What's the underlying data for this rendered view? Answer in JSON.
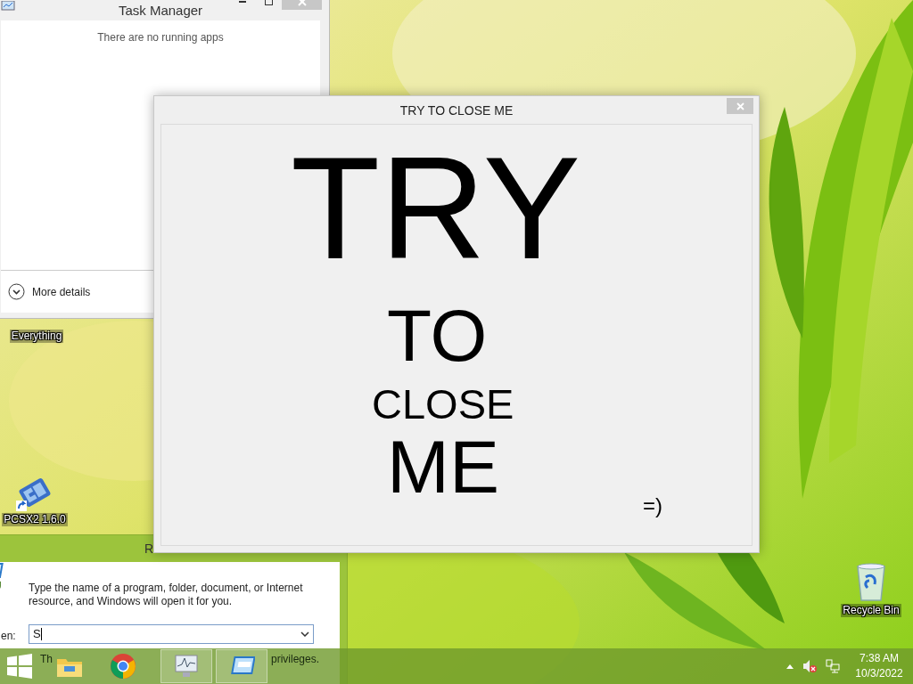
{
  "task_manager": {
    "title": "Task Manager",
    "empty_message": "There are no running apps",
    "more_details": "More details"
  },
  "desktop_icons": [
    {
      "kind": "label_only",
      "label": "Everything"
    },
    {
      "kind": "pcsx2",
      "label": "PCSX2 1.6.0"
    },
    {
      "kind": "recycle_bin",
      "label": "Recycle Bin"
    }
  ],
  "run_dialog": {
    "title": "R",
    "description": "Type the name of a program, folder, document, or Internet resource, and Windows will open it for you.",
    "open_label": "en:",
    "value": "S",
    "admin_note_parts": [
      "Th",
      "privileges."
    ]
  },
  "popup": {
    "title": "TRY TO CLOSE ME",
    "lines": [
      "TRY",
      "TO",
      "CLOSE",
      "ME"
    ],
    "smiley": "=)"
  },
  "taskbar": {
    "apps": [
      {
        "kind": "explorer",
        "running": false
      },
      {
        "kind": "chrome",
        "running": false
      },
      {
        "kind": "task_manager",
        "running": true
      },
      {
        "kind": "run",
        "running": true
      }
    ],
    "clock": {
      "time": "7:38 AM",
      "date": "10/3/2022"
    }
  }
}
